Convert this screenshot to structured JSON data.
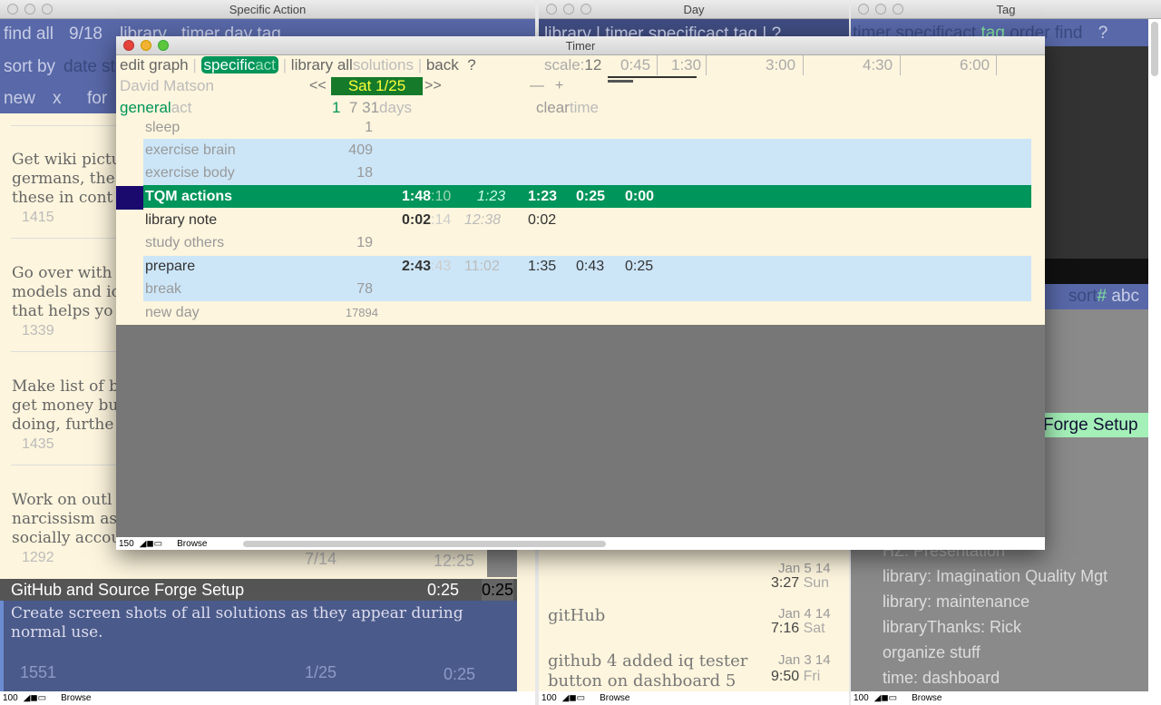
{
  "specific_action": {
    "title": "Specific Action",
    "toolbar": {
      "find_all": "find all",
      "count": "9/18",
      "library": "library",
      "timer_day_tag": "timer day tag",
      "sort_by": "sort by",
      "date": "date",
      "st": "st",
      "new": "new",
      "x": "x",
      "for": "for"
    },
    "items": [
      {
        "text": [
          "Get wiki pictu",
          "germans, the",
          "these in cont"
        ],
        "id": "1415"
      },
      {
        "text": [
          "Go over with",
          "models and ic",
          "that helps yo"
        ],
        "id": "1339"
      },
      {
        "text": [
          "Make list of b",
          "get money bu",
          "doing, furthe"
        ],
        "id": "1435"
      },
      {
        "text": [
          "Work on outl",
          "narcissism as",
          "socially accou"
        ],
        "id": "1292",
        "date": "7/14",
        "time": "12:25"
      }
    ],
    "selected": {
      "title": "GitHub and Source Forge Setup",
      "time": "0:25",
      "time2": "0:25",
      "desc": "Create screen shots of all solutions as they appear during normal use.",
      "id": "1551",
      "date": "1/25",
      "dur": "0:25"
    },
    "status": {
      "zoom": "100",
      "mode": "Browse"
    }
  },
  "day": {
    "title": "Day",
    "toolbar": "library | timer specificact tag | ?",
    "items": [
      {
        "text": "",
        "date": "Jan 5 14",
        "time": "3:27",
        "dow": "Sun"
      },
      {
        "text": "gitHub",
        "date": "Jan 4 14",
        "time": "7:16",
        "dow": "Sat"
      },
      {
        "text": "github 4 added iq tester button on dashboard 5",
        "date": "Jan 3 14",
        "time": "9:50",
        "dow": "Fri"
      }
    ],
    "status": {
      "zoom": "100",
      "mode": "Browse"
    }
  },
  "tag": {
    "title": "Tag",
    "toolbar": {
      "timer": "timer specificact",
      "tag": "tag",
      "order": "order",
      "find": "find",
      "help": "?"
    },
    "sort": {
      "label": "sort",
      "hash": "#",
      "abc": "abc"
    },
    "highlight": "Forge Setup",
    "items": [
      "HZ. Presentation",
      "library: Imagination Quality Mgt",
      "library: maintenance",
      "libraryThanks: Rick",
      "organize stuff",
      "time: dashboard"
    ],
    "status": {
      "zoom": "100",
      "mode": "Browse"
    }
  },
  "timer": {
    "title": "Timer",
    "menu": {
      "edit": "edit",
      "graph": "graph",
      "specific": "specific",
      "act": "act",
      "library": "library",
      "all": "all",
      "solutions": "solutions",
      "back": "back",
      "help": "?"
    },
    "scale": {
      "label": "scale:",
      "value": "12",
      "ticks": [
        "0:45",
        "1:30",
        "3:00",
        "4:30",
        "6:00"
      ]
    },
    "user": "David Matson",
    "prev": "<<",
    "date": "Sat 1/25",
    "next": ">>",
    "minus": "—",
    "plus": "+",
    "general": "general",
    "general_act": "act",
    "days": {
      "d1": "1",
      "d7": "7",
      "d31": "31",
      "label": "days"
    },
    "clear": "clear",
    "clear_time": "time",
    "rows": [
      {
        "name": "sleep",
        "count": "1"
      },
      {
        "name": "exercise brain",
        "count": "409"
      },
      {
        "name": "exercise body",
        "count": "18"
      },
      {
        "name": "TQM actions",
        "total": "1:48",
        "sec": ":10",
        "italic": "1:23",
        "c1": "1:23",
        "c2": "0:25",
        "c3": "0:00"
      },
      {
        "name": "library note",
        "total": "0:02",
        "sec": ":14",
        "italic": "12:38",
        "c1": "0:02"
      },
      {
        "name": "study others",
        "count": "19"
      },
      {
        "name": "prepare",
        "total": "2:43",
        "sec": ":43",
        "italic": "11:02",
        "c1": "1:35",
        "c2": "0:43",
        "c3": "0:25"
      },
      {
        "name": "break",
        "count": "78"
      },
      {
        "name": "new day",
        "count": "17894"
      }
    ],
    "status": {
      "zoom": "150",
      "mode": "Browse"
    }
  },
  "colors": {
    "toolbar_blue": "#5868a8",
    "green": "#00955a",
    "beige": "#fdf5dd",
    "light_blue": "#cce6f8",
    "selected_blue": "#4a5a8a"
  }
}
